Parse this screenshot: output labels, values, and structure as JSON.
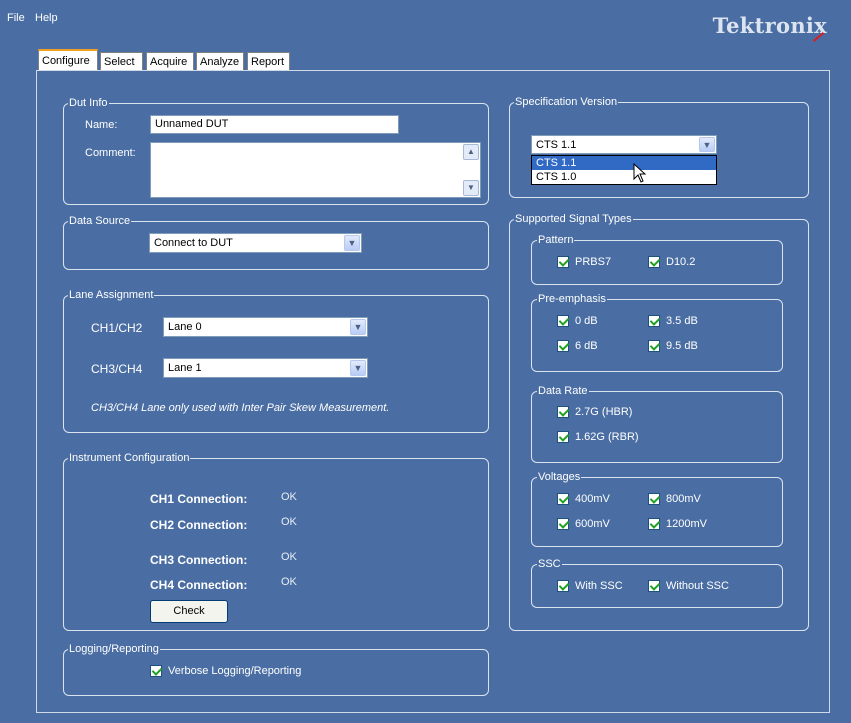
{
  "menu": {
    "file": "File",
    "help": "Help"
  },
  "brand": {
    "logo": "Tektronix",
    "accent": "#d81e28"
  },
  "tabs": [
    {
      "label": "Configure",
      "active": true
    },
    {
      "label": "Select",
      "active": false
    },
    {
      "label": "Acquire",
      "active": false
    },
    {
      "label": "Analyze",
      "active": false
    },
    {
      "label": "Report",
      "active": false
    }
  ],
  "dut_info": {
    "title": "Dut Info",
    "name_label": "Name:",
    "name_value": "Unnamed DUT",
    "comment_label": "Comment:",
    "comment_value": ""
  },
  "data_source": {
    "title": "Data Source",
    "selected": "Connect to DUT"
  },
  "lane_assignment": {
    "title": "Lane Assignment",
    "ch12_label": "CH1/CH2",
    "ch12_value": "Lane 0",
    "ch34_label": "CH3/CH4",
    "ch34_value": "Lane 1",
    "note": "CH3/CH4 Lane only used with Inter Pair Skew Measurement."
  },
  "instrument_config": {
    "title": "Instrument Configuration",
    "connections": [
      {
        "label": "CH1 Connection:",
        "status": "OK"
      },
      {
        "label": "CH2 Connection:",
        "status": "OK"
      },
      {
        "label": "CH3 Connection:",
        "status": "OK"
      },
      {
        "label": "CH4 Connection:",
        "status": "OK"
      }
    ],
    "check_label": "Check"
  },
  "logging": {
    "title": "Logging/Reporting",
    "verbose_label": "Verbose Logging/Reporting",
    "verbose_checked": true
  },
  "spec_version": {
    "title": "Specification Version",
    "selected": "CTS 1.1",
    "options": [
      "CTS 1.1",
      "CTS 1.0"
    ],
    "highlighted": "CTS 1.1"
  },
  "signal_types": {
    "title": "Supported Signal Types",
    "pattern": {
      "title": "Pattern",
      "items": [
        "PRBS7",
        "D10.2"
      ]
    },
    "pre_emphasis": {
      "title": "Pre-emphasis",
      "items": [
        "0 dB",
        "3.5 dB",
        "6 dB",
        "9.5 dB"
      ]
    },
    "data_rate": {
      "title": "Data Rate",
      "items": [
        "2.7G (HBR)",
        "1.62G (RBR)"
      ]
    },
    "voltages": {
      "title": "Voltages",
      "items": [
        "400mV",
        "800mV",
        "600mV",
        "1200mV"
      ]
    },
    "ssc": {
      "title": "SSC",
      "items": [
        "With SSC",
        "Without SSC"
      ]
    }
  },
  "colors": {
    "background": "#4a6ea3",
    "selection": "#316ac5",
    "check": "#21a121"
  }
}
